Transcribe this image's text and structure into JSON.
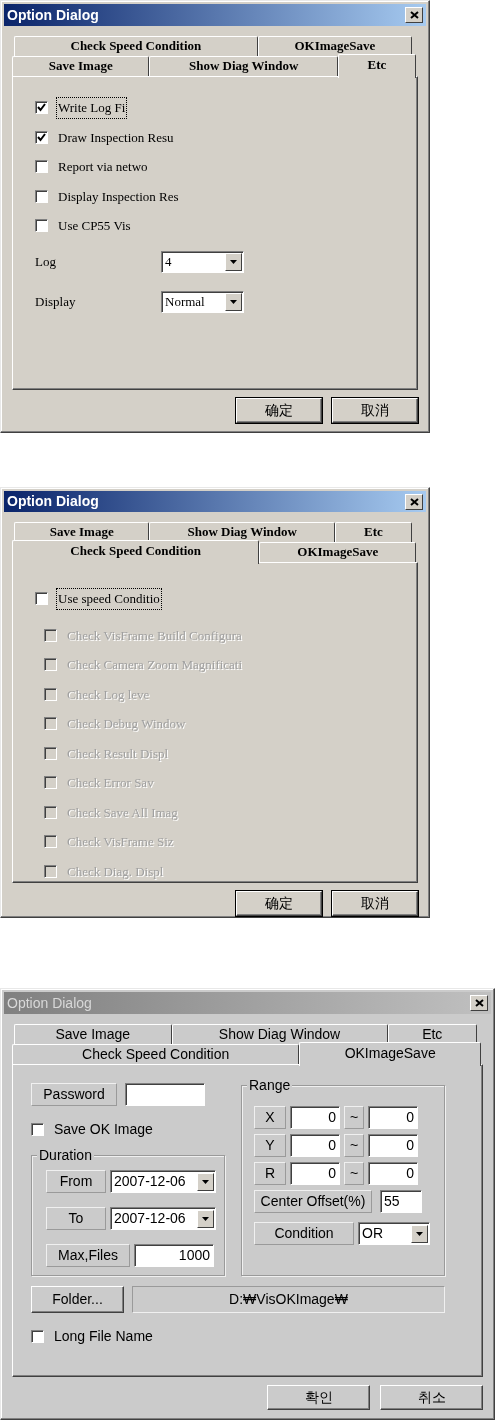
{
  "dialogs": [
    {
      "title": "Option Dialog",
      "active": true,
      "tab_rows": [
        [
          {
            "label": "Check Speed Condition",
            "selected": false
          },
          {
            "label": "OKImageSave",
            "selected": false
          }
        ],
        [
          {
            "label": "Save Image",
            "selected": false
          },
          {
            "label": "Show Diag Window",
            "selected": false
          },
          {
            "label": "Etc",
            "selected": true
          }
        ]
      ],
      "page": {
        "kind": "etc",
        "checkboxes": [
          {
            "label": "Write Log Fi",
            "checked": true,
            "focused": true
          },
          {
            "label": "Draw Inspection Resu",
            "checked": true,
            "focused": false
          },
          {
            "label": "Report via netwo",
            "checked": false,
            "focused": false
          },
          {
            "label": "Display Inspection Res",
            "checked": false,
            "focused": false
          },
          {
            "label": "Use CP55 Vis",
            "checked": false,
            "focused": false
          }
        ],
        "selects": [
          {
            "label": "Log",
            "value": "4"
          },
          {
            "label": "Display",
            "value": "Normal"
          }
        ]
      },
      "buttons": [
        "确定",
        "取消"
      ]
    },
    {
      "title": "Option Dialog",
      "active": true,
      "tab_rows": [
        [
          {
            "label": "Save Image",
            "selected": false
          },
          {
            "label": "Show Diag Window",
            "selected": false
          },
          {
            "label": "Etc",
            "selected": false
          }
        ],
        [
          {
            "label": "Check Speed Condition",
            "selected": true
          },
          {
            "label": "OKImageSave",
            "selected": false
          }
        ]
      ],
      "page": {
        "kind": "speed",
        "master": {
          "label": "Use speed Conditio",
          "checked": false,
          "focused": true
        },
        "checks": [
          {
            "label": "Check VisFrame Build Configura",
            "checked": false,
            "disabled": true
          },
          {
            "label": "Check Camera Zoom Magnificati",
            "checked": false,
            "disabled": true
          },
          {
            "label": "Check Log leve",
            "checked": false,
            "disabled": true
          },
          {
            "label": "Check Debug Window",
            "checked": false,
            "disabled": true
          },
          {
            "label": "Check Result Displ",
            "checked": false,
            "disabled": true
          },
          {
            "label": "Check Error Sav",
            "checked": false,
            "disabled": true
          },
          {
            "label": "Check Save All Imag",
            "checked": false,
            "disabled": true
          },
          {
            "label": "Check VisFrame Siz",
            "checked": false,
            "disabled": true
          },
          {
            "label": "Check Diag. Displ",
            "checked": false,
            "disabled": true
          }
        ]
      },
      "buttons": [
        "确定",
        "取消"
      ]
    },
    {
      "title": "Option Dialog",
      "active": false,
      "tab_rows": [
        [
          {
            "label": "Save Image",
            "selected": false
          },
          {
            "label": "Show Diag Window",
            "selected": false
          },
          {
            "label": "Etc",
            "selected": false
          }
        ],
        [
          {
            "label": "Check Speed Condition",
            "selected": false
          },
          {
            "label": "OKImageSave",
            "selected": true
          }
        ]
      ],
      "page": {
        "kind": "okimage",
        "password": {
          "label": "Password"
        },
        "save_ok": {
          "label": "Save OK Image",
          "checked": false
        },
        "duration": {
          "title": "Duration",
          "rows": [
            {
              "kind": "date",
              "label": "From",
              "value": "2007-12-06"
            },
            {
              "kind": "date",
              "label": "To",
              "value": "2007-12-06"
            },
            {
              "kind": "number",
              "label": "Max,Files",
              "value": "1000"
            }
          ]
        },
        "range": {
          "title": "Range",
          "rows": [
            {
              "label": "X",
              "from": "0",
              "separator": "~",
              "to": "0"
            },
            {
              "label": "Y",
              "from": "0",
              "separator": "~",
              "to": "0"
            },
            {
              "label": "R",
              "from": "0",
              "separator": "~",
              "to": "0"
            }
          ],
          "center_offset": {
            "label": "Center Offset(%)",
            "value": "55"
          },
          "condition": {
            "label": "Condition",
            "value": "OR"
          }
        },
        "folder_button": "Folder...",
        "folder_path": "D:₩VisOKImage₩",
        "long_file_name": {
          "label": "Long File Name",
          "checked": false
        }
      },
      "buttons": [
        "확인",
        "취소"
      ]
    }
  ]
}
